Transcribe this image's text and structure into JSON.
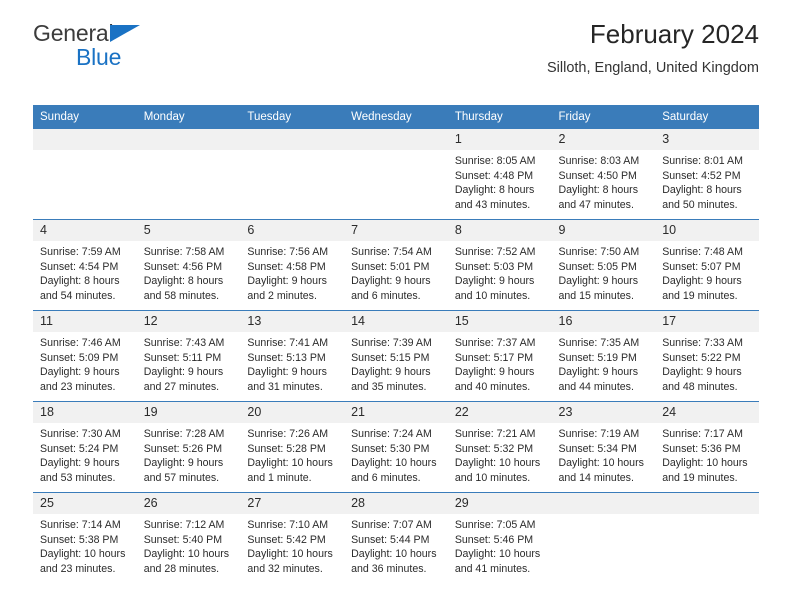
{
  "brand": {
    "line1": "General",
    "line2": "Blue",
    "mark": "triangle-logo",
    "color_dark": "#3c3c3c",
    "color_blue": "#1a72c4"
  },
  "header": {
    "title": "February 2024",
    "subtitle": "Silloth, England, United Kingdom"
  },
  "theme": {
    "header_row_bg": "#3a7cba",
    "daynum_bg": "#f1f1f1",
    "grid_line": "#3a7cba",
    "text": "#2b2b2b"
  },
  "columns": [
    "Sunday",
    "Monday",
    "Tuesday",
    "Wednesday",
    "Thursday",
    "Friday",
    "Saturday"
  ],
  "weeks": [
    [
      {
        "day": "",
        "lines": []
      },
      {
        "day": "",
        "lines": []
      },
      {
        "day": "",
        "lines": []
      },
      {
        "day": "",
        "lines": []
      },
      {
        "day": "1",
        "lines": [
          "Sunrise: 8:05 AM",
          "Sunset: 4:48 PM",
          "Daylight: 8 hours",
          "and 43 minutes."
        ]
      },
      {
        "day": "2",
        "lines": [
          "Sunrise: 8:03 AM",
          "Sunset: 4:50 PM",
          "Daylight: 8 hours",
          "and 47 minutes."
        ]
      },
      {
        "day": "3",
        "lines": [
          "Sunrise: 8:01 AM",
          "Sunset: 4:52 PM",
          "Daylight: 8 hours",
          "and 50 minutes."
        ]
      }
    ],
    [
      {
        "day": "4",
        "lines": [
          "Sunrise: 7:59 AM",
          "Sunset: 4:54 PM",
          "Daylight: 8 hours",
          "and 54 minutes."
        ]
      },
      {
        "day": "5",
        "lines": [
          "Sunrise: 7:58 AM",
          "Sunset: 4:56 PM",
          "Daylight: 8 hours",
          "and 58 minutes."
        ]
      },
      {
        "day": "6",
        "lines": [
          "Sunrise: 7:56 AM",
          "Sunset: 4:58 PM",
          "Daylight: 9 hours",
          "and 2 minutes."
        ]
      },
      {
        "day": "7",
        "lines": [
          "Sunrise: 7:54 AM",
          "Sunset: 5:01 PM",
          "Daylight: 9 hours",
          "and 6 minutes."
        ]
      },
      {
        "day": "8",
        "lines": [
          "Sunrise: 7:52 AM",
          "Sunset: 5:03 PM",
          "Daylight: 9 hours",
          "and 10 minutes."
        ]
      },
      {
        "day": "9",
        "lines": [
          "Sunrise: 7:50 AM",
          "Sunset: 5:05 PM",
          "Daylight: 9 hours",
          "and 15 minutes."
        ]
      },
      {
        "day": "10",
        "lines": [
          "Sunrise: 7:48 AM",
          "Sunset: 5:07 PM",
          "Daylight: 9 hours",
          "and 19 minutes."
        ]
      }
    ],
    [
      {
        "day": "11",
        "lines": [
          "Sunrise: 7:46 AM",
          "Sunset: 5:09 PM",
          "Daylight: 9 hours",
          "and 23 minutes."
        ]
      },
      {
        "day": "12",
        "lines": [
          "Sunrise: 7:43 AM",
          "Sunset: 5:11 PM",
          "Daylight: 9 hours",
          "and 27 minutes."
        ]
      },
      {
        "day": "13",
        "lines": [
          "Sunrise: 7:41 AM",
          "Sunset: 5:13 PM",
          "Daylight: 9 hours",
          "and 31 minutes."
        ]
      },
      {
        "day": "14",
        "lines": [
          "Sunrise: 7:39 AM",
          "Sunset: 5:15 PM",
          "Daylight: 9 hours",
          "and 35 minutes."
        ]
      },
      {
        "day": "15",
        "lines": [
          "Sunrise: 7:37 AM",
          "Sunset: 5:17 PM",
          "Daylight: 9 hours",
          "and 40 minutes."
        ]
      },
      {
        "day": "16",
        "lines": [
          "Sunrise: 7:35 AM",
          "Sunset: 5:19 PM",
          "Daylight: 9 hours",
          "and 44 minutes."
        ]
      },
      {
        "day": "17",
        "lines": [
          "Sunrise: 7:33 AM",
          "Sunset: 5:22 PM",
          "Daylight: 9 hours",
          "and 48 minutes."
        ]
      }
    ],
    [
      {
        "day": "18",
        "lines": [
          "Sunrise: 7:30 AM",
          "Sunset: 5:24 PM",
          "Daylight: 9 hours",
          "and 53 minutes."
        ]
      },
      {
        "day": "19",
        "lines": [
          "Sunrise: 7:28 AM",
          "Sunset: 5:26 PM",
          "Daylight: 9 hours",
          "and 57 minutes."
        ]
      },
      {
        "day": "20",
        "lines": [
          "Sunrise: 7:26 AM",
          "Sunset: 5:28 PM",
          "Daylight: 10 hours",
          "and 1 minute."
        ]
      },
      {
        "day": "21",
        "lines": [
          "Sunrise: 7:24 AM",
          "Sunset: 5:30 PM",
          "Daylight: 10 hours",
          "and 6 minutes."
        ]
      },
      {
        "day": "22",
        "lines": [
          "Sunrise: 7:21 AM",
          "Sunset: 5:32 PM",
          "Daylight: 10 hours",
          "and 10 minutes."
        ]
      },
      {
        "day": "23",
        "lines": [
          "Sunrise: 7:19 AM",
          "Sunset: 5:34 PM",
          "Daylight: 10 hours",
          "and 14 minutes."
        ]
      },
      {
        "day": "24",
        "lines": [
          "Sunrise: 7:17 AM",
          "Sunset: 5:36 PM",
          "Daylight: 10 hours",
          "and 19 minutes."
        ]
      }
    ],
    [
      {
        "day": "25",
        "lines": [
          "Sunrise: 7:14 AM",
          "Sunset: 5:38 PM",
          "Daylight: 10 hours",
          "and 23 minutes."
        ]
      },
      {
        "day": "26",
        "lines": [
          "Sunrise: 7:12 AM",
          "Sunset: 5:40 PM",
          "Daylight: 10 hours",
          "and 28 minutes."
        ]
      },
      {
        "day": "27",
        "lines": [
          "Sunrise: 7:10 AM",
          "Sunset: 5:42 PM",
          "Daylight: 10 hours",
          "and 32 minutes."
        ]
      },
      {
        "day": "28",
        "lines": [
          "Sunrise: 7:07 AM",
          "Sunset: 5:44 PM",
          "Daylight: 10 hours",
          "and 36 minutes."
        ]
      },
      {
        "day": "29",
        "lines": [
          "Sunrise: 7:05 AM",
          "Sunset: 5:46 PM",
          "Daylight: 10 hours",
          "and 41 minutes."
        ]
      },
      {
        "day": "",
        "lines": []
      },
      {
        "day": "",
        "lines": []
      }
    ]
  ]
}
